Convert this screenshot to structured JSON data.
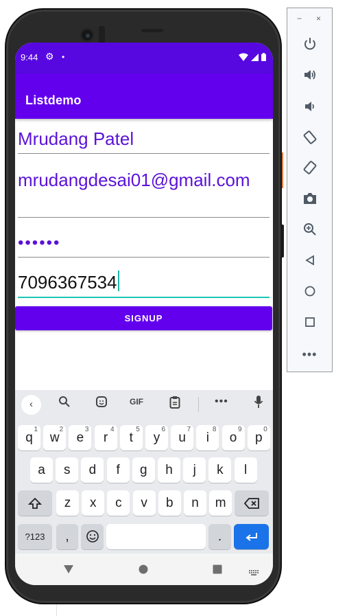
{
  "statusbar": {
    "time": "9:44"
  },
  "appbar": {
    "title": "Listdemo"
  },
  "form": {
    "name_value": "Mrudang Patel",
    "email_value": "mrudangdesai01@gmail.com",
    "password_masked": "••••••",
    "phone_value": "7096367534",
    "signup_label": "SIGNUP"
  },
  "keyboard": {
    "toolbar": {
      "gif_label": "GIF"
    },
    "row1": [
      {
        "k": "q",
        "s": "1"
      },
      {
        "k": "w",
        "s": "2"
      },
      {
        "k": "e",
        "s": "3"
      },
      {
        "k": "r",
        "s": "4"
      },
      {
        "k": "t",
        "s": "5"
      },
      {
        "k": "y",
        "s": "6"
      },
      {
        "k": "u",
        "s": "7"
      },
      {
        "k": "i",
        "s": "8"
      },
      {
        "k": "o",
        "s": "9"
      },
      {
        "k": "p",
        "s": "0"
      }
    ],
    "row2": [
      "a",
      "s",
      "d",
      "f",
      "g",
      "h",
      "j",
      "k",
      "l"
    ],
    "row3": [
      "z",
      "x",
      "c",
      "v",
      "b",
      "n",
      "m"
    ],
    "symbols_label": "?123",
    "comma_label": ",",
    "period_label": "."
  },
  "colors": {
    "statusbar": "#5708e0",
    "appbar": "#6200ee",
    "field_text": "#5a12d8",
    "focus_underline": "#1bc7b6",
    "enter_key": "#1a73e8"
  },
  "emulator_panel": {
    "icons": [
      "minimize-icon",
      "close-icon",
      "power-icon",
      "volume-up-icon",
      "volume-down-icon",
      "rotate-left-icon",
      "rotate-right-icon",
      "camera-icon",
      "zoom-icon",
      "back-icon",
      "home-icon",
      "overview-icon",
      "more-icon"
    ]
  }
}
